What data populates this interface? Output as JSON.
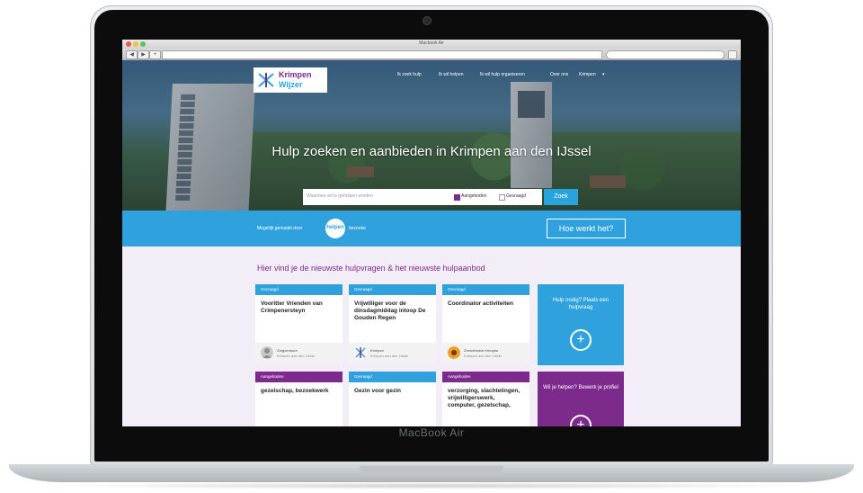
{
  "browser": {
    "window_title": "Macbook Air",
    "back_glyph": "◀",
    "forward_glyph": "▶",
    "reload_glyph": "+"
  },
  "site": {
    "logo": {
      "line1": "Krimpen",
      "line2": "Wijzer"
    },
    "nav": [
      "Ik zoek hulp",
      "Ik wil helpen",
      "Ik wil hulp organiseren",
      "Over ons",
      "Krimpen"
    ],
    "hero_title": "Hulp zoeken en aanbieden in Krimpen aan den IJssel",
    "search": {
      "placeholder": "Waarmee wil je geholpen worden",
      "option1": "Aangeboden",
      "option2": "Gevraagd",
      "button": "Zoek"
    },
    "band": {
      "text_before": "Mogelijk gemaakt door",
      "logo_text": "helpen",
      "text_after": "bezoeke",
      "how_button": "Hoe werkt het?"
    },
    "section_title": "Hier vind je de nieuwste hulpvragen & het nieuwste hulpaanbod",
    "cards": [
      {
        "tag": "Gevraagd",
        "title": "Vooritter Vrienden van Crimpenersteyn",
        "author": "Zorgcentrum",
        "place": "Krimpen aan den IJssel"
      },
      {
        "tag": "Gevraagd",
        "title": "Vrijwilliger voor de dinsdagmiddag inloop De Gouden Regen",
        "author": "Krimpen",
        "place": "Krimpen aan den IJssel"
      },
      {
        "tag": "Gevraagd",
        "title": "Coordinator activiteiten",
        "author": "Zonnebloem Krimpen",
        "place": "Krimpen aan den IJssel"
      },
      {
        "tag": "Aangeboden",
        "title": "gezelschap, bezoekwerk"
      },
      {
        "tag": "Gevraagd",
        "title": "Gezin voor gezin"
      },
      {
        "tag": "Aangeboden",
        "title": "verzorging, slachtelingen, vrijwilligerswerk, computer, gezelschap,"
      }
    ],
    "side_cards": [
      {
        "text": "Hulp nodig? Plaats een hulpvraag",
        "color": "#2fa1dc"
      },
      {
        "text": "Wil je helpen? Bewerk je profiel",
        "color": "#7c2a8c"
      }
    ]
  },
  "device": {
    "brand": "MacBook Air"
  },
  "colors": {
    "purple": "#7c2a8c",
    "blue": "#2fa1dc"
  }
}
